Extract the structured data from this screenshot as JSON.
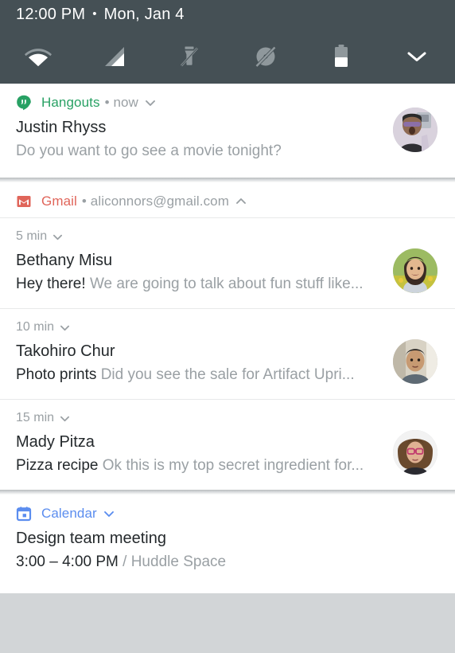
{
  "statusbar": {
    "time": "12:00 PM",
    "separator": "•",
    "date": "Mon, Jan 4",
    "icons": [
      {
        "name": "wifi-icon",
        "label": "Wi-Fi"
      },
      {
        "name": "cell-signal-icon",
        "label": "Mobile signal"
      },
      {
        "name": "flashlight-off-icon",
        "label": "Flashlight off"
      },
      {
        "name": "rotation-lock-off-icon",
        "label": "Auto-rotate off"
      },
      {
        "name": "battery-icon",
        "label": "Battery"
      },
      {
        "name": "chevron-down-icon",
        "label": "Expand quick settings"
      }
    ],
    "battery_level_percent": 45,
    "background_color": "#455055"
  },
  "notifications": [
    {
      "app": "Hangouts",
      "app_color": "#28a164",
      "meta": "• now",
      "expand_state": "collapsed",
      "title": "Justin Rhyss",
      "body": "Do you want to go see a movie tonight?",
      "body_strong": "",
      "avatar": "justin-rhyss-avatar"
    },
    {
      "app": "Gmail",
      "app_color": "#e0655a",
      "meta": "• aliconnors@gmail.com",
      "expand_state": "expanded",
      "messages": [
        {
          "time": "5 min",
          "sender": "Bethany Misu",
          "subject": "Hey there!",
          "preview": "We are going to talk about fun stuff like...",
          "avatar": "bethany-misu-avatar"
        },
        {
          "time": "10 min",
          "sender": "Takohiro Chur",
          "subject": "Photo prints",
          "preview": "Did you see the sale for Artifact Upri...",
          "avatar": "takohiro-chur-avatar"
        },
        {
          "time": "15 min",
          "sender": "Mady Pitza",
          "subject": "Pizza recipe",
          "preview": "Ok this is my top secret ingredient for...",
          "avatar": "mady-pitza-avatar"
        }
      ]
    },
    {
      "app": "Calendar",
      "app_color": "#5b8def",
      "meta": "",
      "expand_state": "collapsed",
      "title": "Design team meeting",
      "body_strong": "3:00 – 4:00 PM",
      "body": " / Huddle Space"
    }
  ]
}
